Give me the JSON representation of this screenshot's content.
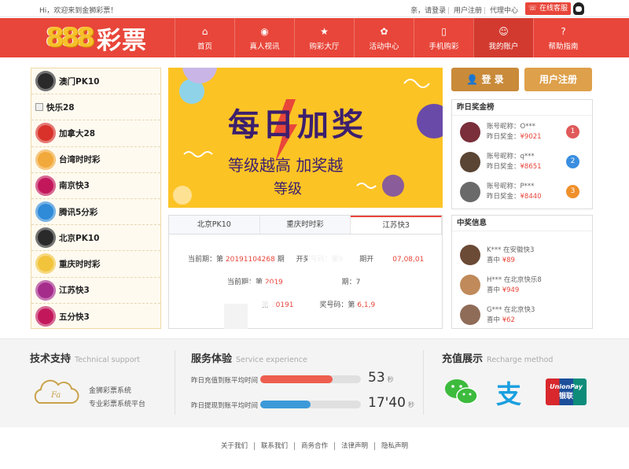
{
  "top": {
    "greeting": "Hi，欢迎来到金狮彩票！",
    "links": [
      "亲，请登录",
      "用户注册",
      "代理中心"
    ],
    "service": "在线客服"
  },
  "logo": {
    "num": "888",
    "text": "彩票"
  },
  "nav": [
    {
      "label": "首页",
      "icon": "home-icon",
      "glyph": "⌂"
    },
    {
      "label": "真人视讯",
      "icon": "chip-icon",
      "glyph": "◉"
    },
    {
      "label": "购彩大厅",
      "icon": "star-icon",
      "glyph": "★"
    },
    {
      "label": "活动中心",
      "icon": "gift-icon",
      "glyph": "✿"
    },
    {
      "label": "手机购彩",
      "icon": "phone-icon",
      "glyph": "▯"
    },
    {
      "label": "我的账户",
      "icon": "user-icon",
      "glyph": "☺"
    },
    {
      "label": "帮助指南",
      "icon": "help-icon",
      "glyph": "?"
    }
  ],
  "lotteries": [
    {
      "label": "澳门PK10",
      "color": "#2a2a2a",
      "badge": ""
    },
    {
      "label": "快乐28",
      "color": "",
      "badge": ""
    },
    {
      "label": "加拿大28",
      "color": "#d8322a",
      "badge": "加拿大28"
    },
    {
      "label": "台湾时时彩",
      "color": "#f2a93b",
      "badge": ""
    },
    {
      "label": "南京快3",
      "color": "#c2185b",
      "badge": ""
    },
    {
      "label": "腾讯5分彩",
      "color": "#2f8ad8",
      "badge": ""
    },
    {
      "label": "北京PK10",
      "color": "#2a2a2a",
      "badge": ""
    },
    {
      "label": "重庆时时彩",
      "color": "#f2c43b",
      "badge": ""
    },
    {
      "label": "江苏快3",
      "color": "#a62c8c",
      "badge": "江苏快3"
    },
    {
      "label": "五分快3",
      "color": "#c2185b",
      "badge": ""
    }
  ],
  "banner": {
    "title": "每日加奖",
    "line2": "等级越高 加奖越",
    "line3": "等级",
    "bg": "#fcc325"
  },
  "tabs": {
    "items": [
      "北京PK10",
      "重庆时时彩",
      "江苏快3"
    ],
    "active": 2
  },
  "draw": {
    "r1_prefix": "当前期：第 ",
    "r1_period": "20191104268",
    "r1_qi": " 期",
    "r1_label": "开奖号码：第",
    "r1_mid": "9",
    "r1_tail": "期开",
    "r1_nums": "07,08,01",
    "r2_prefix": "当前期：第 ",
    "r2_period": "2019",
    "r2_tail": "期：7",
    "r3_prefix": "第 ",
    "r3_period": "20191",
    "r3_label": "奖号码：第 ",
    "r3_nums": "6,1,9"
  },
  "auth": {
    "login": "登 录",
    "register": "用户注册"
  },
  "ranking": {
    "title": "昨日奖金榜",
    "items": [
      {
        "name": "账号昵称：O***",
        "prize_label": "昨日奖金：",
        "amount": "¥9021",
        "rank": "1",
        "color": "#e05a5a"
      },
      {
        "name": "账号昵称：q***",
        "prize_label": "昨日奖金：",
        "amount": "¥8651",
        "rank": "2",
        "color": "#3a8ee0"
      },
      {
        "name": "账号昵称：P***",
        "prize_label": "昨日奖金：",
        "amount": "¥8440",
        "rank": "3",
        "color": "#f0902a"
      }
    ]
  },
  "winners": {
    "title": "中奖信息",
    "items": [
      {
        "line": "K*** 在安徽快3",
        "win_label": "喜中 ",
        "amount": "¥89"
      },
      {
        "line": "H*** 在北京快乐8",
        "win_label": "喜中 ",
        "amount": "¥949"
      },
      {
        "line": "G*** 在北京快3",
        "win_label": "喜中 ",
        "amount": "¥62"
      }
    ]
  },
  "support": {
    "title": "技术支持",
    "en": "Technical support",
    "line1": "金狮彩票系统",
    "line2": "专业彩票系统平台",
    "logo_text": "Fa"
  },
  "service": {
    "title": "服务体验",
    "en": "Service experience",
    "bars": [
      {
        "label": "昨日充值到账平均时间",
        "value": "53",
        "unit": "秒",
        "fill": 0.72,
        "color": "#ee5e4e"
      },
      {
        "label": "昨日提现到账平均时间",
        "value": "17'40",
        "unit": "秒",
        "fill": 0.5,
        "color": "#3c9ad8"
      }
    ]
  },
  "recharge": {
    "title": "充值展示",
    "en": "Recharge method",
    "methods": [
      "微信",
      "支",
      "UnionPay",
      "银联"
    ]
  },
  "footer": [
    "关于我们",
    "联系我们",
    "商务合作",
    "法律声明",
    "隐私声明"
  ]
}
